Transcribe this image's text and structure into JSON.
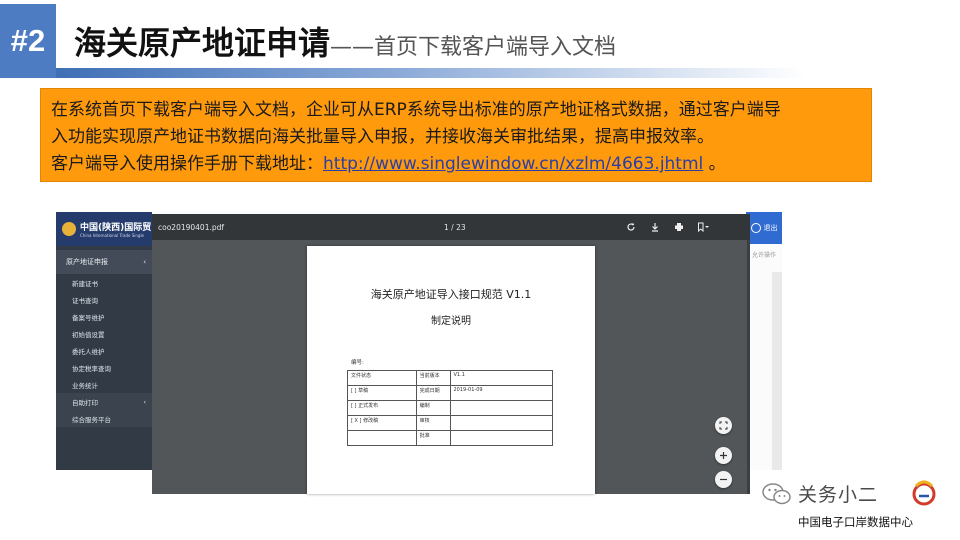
{
  "slide": {
    "number": "#2",
    "title": "海关原产地证申请",
    "subtitle": "——首页下载客户端导入文档"
  },
  "info": {
    "line1": "在系统首页下载客户端导入文档，企业可从ERP系统导出标准的原产地证格式数据，通过客户端导",
    "line2": "入功能实现原产地证书数据向海关批量导入申报，并接收海关审批结果，提高申报效率。",
    "line3_prefix": "客户端导入使用操作手册下载地址：",
    "link": "http://www.singlewindow.cn/xzlm/4663.jhtml",
    "line3_suffix": " 。"
  },
  "app": {
    "brand": "中国(陕西)国际贸",
    "brand_sub": "China International Trade Single",
    "section": "原产地证申报",
    "menu": [
      "新建证书",
      "证书查询",
      "备案号维护",
      "初始值设置",
      "委托人维护",
      "协定税率查询",
      "业务统计"
    ],
    "group_item": "自助打印",
    "last_item": "综合服务平台",
    "logout": "退出",
    "col_op": "允许操作"
  },
  "pdf": {
    "filename": "coo20190401.pdf",
    "page_indicator": "1 / 23",
    "doc_title": "海关原产地证导入接口规范 V1.1",
    "doc_subtitle": "制定说明",
    "code_label": "编号:",
    "table": {
      "status_label": "文件状态",
      "draft": "[ ] 草稿",
      "released": "[ ] 正式发布",
      "revising": "[ X ] 修改稿",
      "current_version_label": "当前版本",
      "current_version": "V1.1",
      "finish_date_label": "完成日期",
      "finish_date": "2019-01-09",
      "author_label": "编制",
      "reviewer_label": "审核",
      "approver_label": "批准"
    }
  },
  "watermark": {
    "name": "关务小二",
    "org": "中国电子口岸数据中心"
  },
  "icons": [
    "rotate-icon",
    "download-icon",
    "print-icon",
    "bookmark-icon",
    "fit-page-icon",
    "zoom-in-icon",
    "zoom-out-icon",
    "wechat-icon"
  ]
}
